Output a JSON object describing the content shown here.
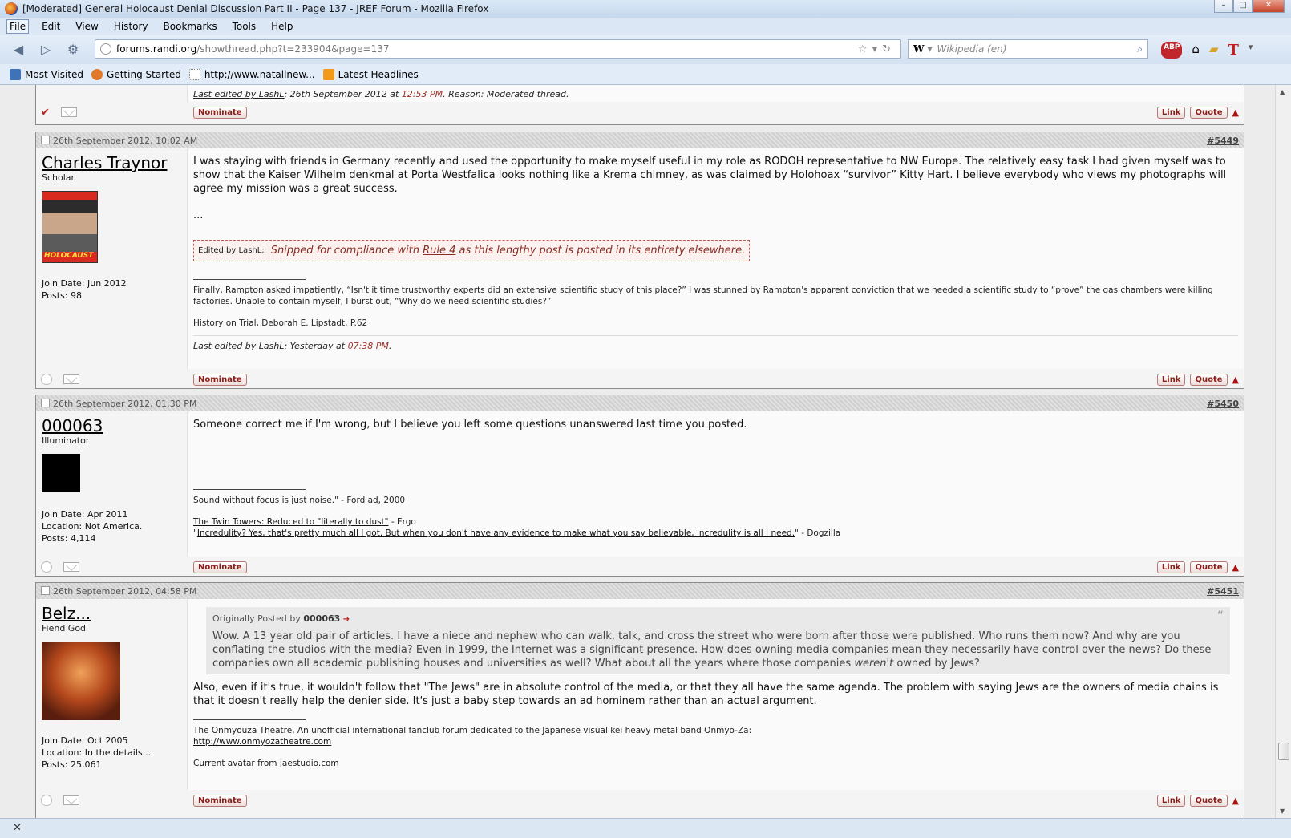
{
  "window": {
    "title": "[Moderated] General Holocaust Denial Discussion Part II - Page 137 - JREF Forum - Mozilla Firefox"
  },
  "menu": [
    "File",
    "Edit",
    "View",
    "History",
    "Bookmarks",
    "Tools",
    "Help"
  ],
  "urlbar": {
    "host": "forums.randi.org",
    "path": "/showthread.php?t=233904&page=137"
  },
  "search": {
    "placeholder": "Wikipedia (en)",
    "engine": "W"
  },
  "bookmarks": [
    {
      "label": "Most Visited",
      "icon": "most-visited-icon",
      "color": "#3f73b8"
    },
    {
      "label": "Getting Started",
      "icon": "firefox-icon",
      "color": "#e07a2a"
    },
    {
      "label": "http://www.natallnew...",
      "icon": "page-icon",
      "color": "#ffffff"
    },
    {
      "label": "Latest Headlines",
      "icon": "rss-icon",
      "color": "#f39a1b"
    }
  ],
  "top_post": {
    "lastedit_prefix": "Last edited by LashL",
    "lastedit_mid": "; 26th September 2012 at ",
    "lastedit_time": "12:53 PM",
    "lastedit_reason": ". Reason: Moderated thread.",
    "nominate": "Nominate",
    "link": "Link",
    "quote": "Quote"
  },
  "posts": [
    {
      "date": "26th September 2012, 10:02 AM",
      "number": "#5449",
      "username": "Charles Traynor",
      "usertitle": "Scholar",
      "avatar_text": "HOLOCAUST",
      "join": "Join Date: Jun 2012",
      "posts": "Posts: 98",
      "body": "I was staying with friends in Germany recently and used the opportunity to make myself useful in my role as RODOH representative to NW Europe. The relatively easy task I had given myself was to show that the Kaiser Wilhelm denkmal at Porta Westfalica looks nothing like a Krema chimney, as was claimed by Holohoax “survivor” Kitty Hart. I believe everybody who views my photographs will agree my mission was a great success.",
      "ellipsis": "...",
      "edit_label": "Edited by LashL:",
      "edit_text_a": "Snipped for compliance with ",
      "edit_rule": "Rule 4",
      "edit_text_b": " as this lengthy post is posted in its entirety elsewhere.",
      "sig1": "Finally, Rampton asked impatiently, “Isn't it time trustworthy experts did an extensive scientific study of this place?” I was stunned by Rampton's apparent conviction that we needed a scientific study to “prove” the gas chambers were killing factories. Unable to contain myself, I burst out, “Why do we need scientific studies?”",
      "sig2": "History on Trial, Deborah E. Lipstadt, P.62",
      "lastedit_prefix": "Last edited by LashL",
      "lastedit_mid": "; Yesterday at ",
      "lastedit_time": "07:38 PM",
      "lastedit_end": "."
    },
    {
      "date": "26th September 2012, 01:30 PM",
      "number": "#5450",
      "username": "000063",
      "usertitle": "Illuminator",
      "join": "Join Date: Apr 2011",
      "location": "Location: Not America.",
      "posts": "Posts: 4,114",
      "body": "Someone correct me if I'm wrong, but I believe you left some questions unanswered last time you posted.",
      "sig1": "Sound without focus is just noise.\" - Ford ad, 2000",
      "sig2_link": "The Twin Towers: Reduced to \"literally to dust\"",
      "sig2_tail": " - Ergo",
      "sig3_link": "Incredulity? Yes, that's pretty much all I got. But when you don't have any evidence to make what you say believable, incredulity is all I need.",
      "sig3_head": "\"",
      "sig3_tail": "\" - Dogzilla"
    },
    {
      "date": "26th September 2012, 04:58 PM",
      "number": "#5451",
      "username": "Belz...",
      "usertitle": "Fiend God",
      "join": "Join Date: Oct 2005",
      "location": "Location: In the details...",
      "posts": "Posts: 25,061",
      "quote_prefix": "Originally Posted by ",
      "quote_author": "000063",
      "quote_text_a": "Wow. A 13 year old pair of articles. I have a niece and nephew who can walk, talk, and cross the street who were born after those were published. Who runs them now? And why are you conflating the studios with the media? Even in 1999, the Internet was a significant presence. How does owning media companies mean they necessarily have control over the news? Do these companies own all academic publishing houses and universities as well? What about all the years where those companies ",
      "quote_em": "weren't",
      "quote_text_b": " owned by Jews?",
      "body": "Also, even if it's true, it wouldn't follow that \"The Jews\" are in absolute control of the media, or that they all have the same agenda. The problem with saying Jews are the owners of media chains is that it doesn't really help the denier side. It's just a baby step towards an ad hominem rather than an actual argument.",
      "sig1": "The Onmyouza Theatre, An unofficial international fanclub forum dedicated to the Japanese visual kei heavy metal band Onmyo-Za:",
      "sig2": "http://www.onmyozatheatre.com",
      "sig3": "Current avatar from Jaestudio.com"
    }
  ],
  "buttons": {
    "nominate": "Nominate",
    "link": "Link",
    "quote": "Quote"
  }
}
